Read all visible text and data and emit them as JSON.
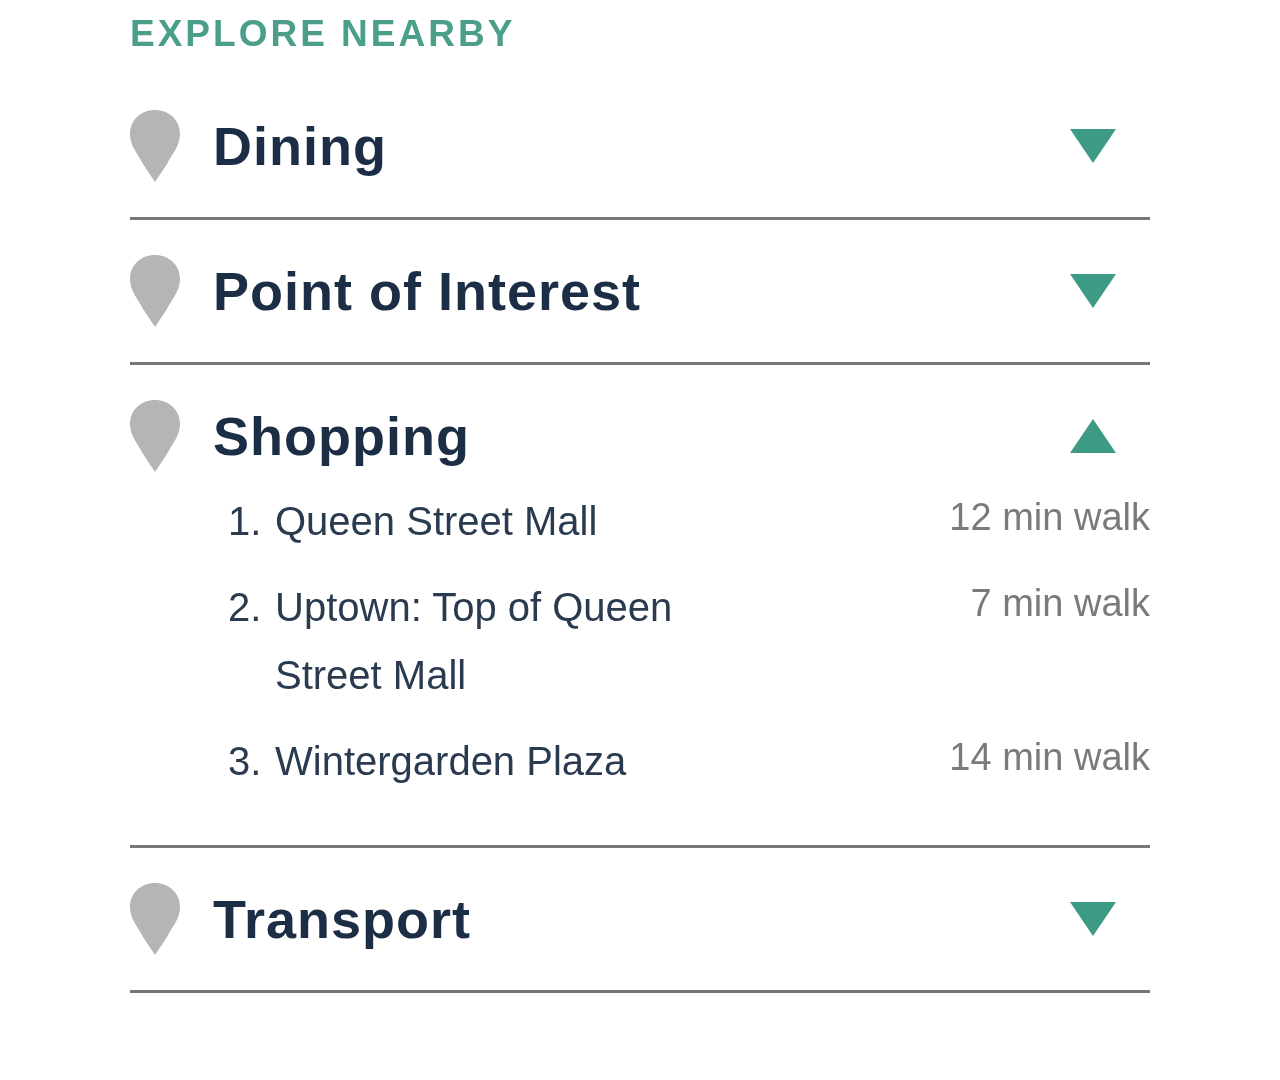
{
  "title": "EXPLORE NEARBY",
  "categories": [
    {
      "name": "Dining",
      "expanded": false
    },
    {
      "name": "Point of Interest",
      "expanded": false
    },
    {
      "name": "Shopping",
      "expanded": true,
      "items": [
        {
          "number": "1.",
          "name": "Queen Street Mall",
          "walk": "12 min walk"
        },
        {
          "number": "2.",
          "name": "Uptown: Top of Queen Street Mall",
          "walk": "7 min walk"
        },
        {
          "number": "3.",
          "name": "Wintergarden Plaza",
          "walk": "14 min walk"
        }
      ]
    },
    {
      "name": "Transport",
      "expanded": false
    }
  ]
}
